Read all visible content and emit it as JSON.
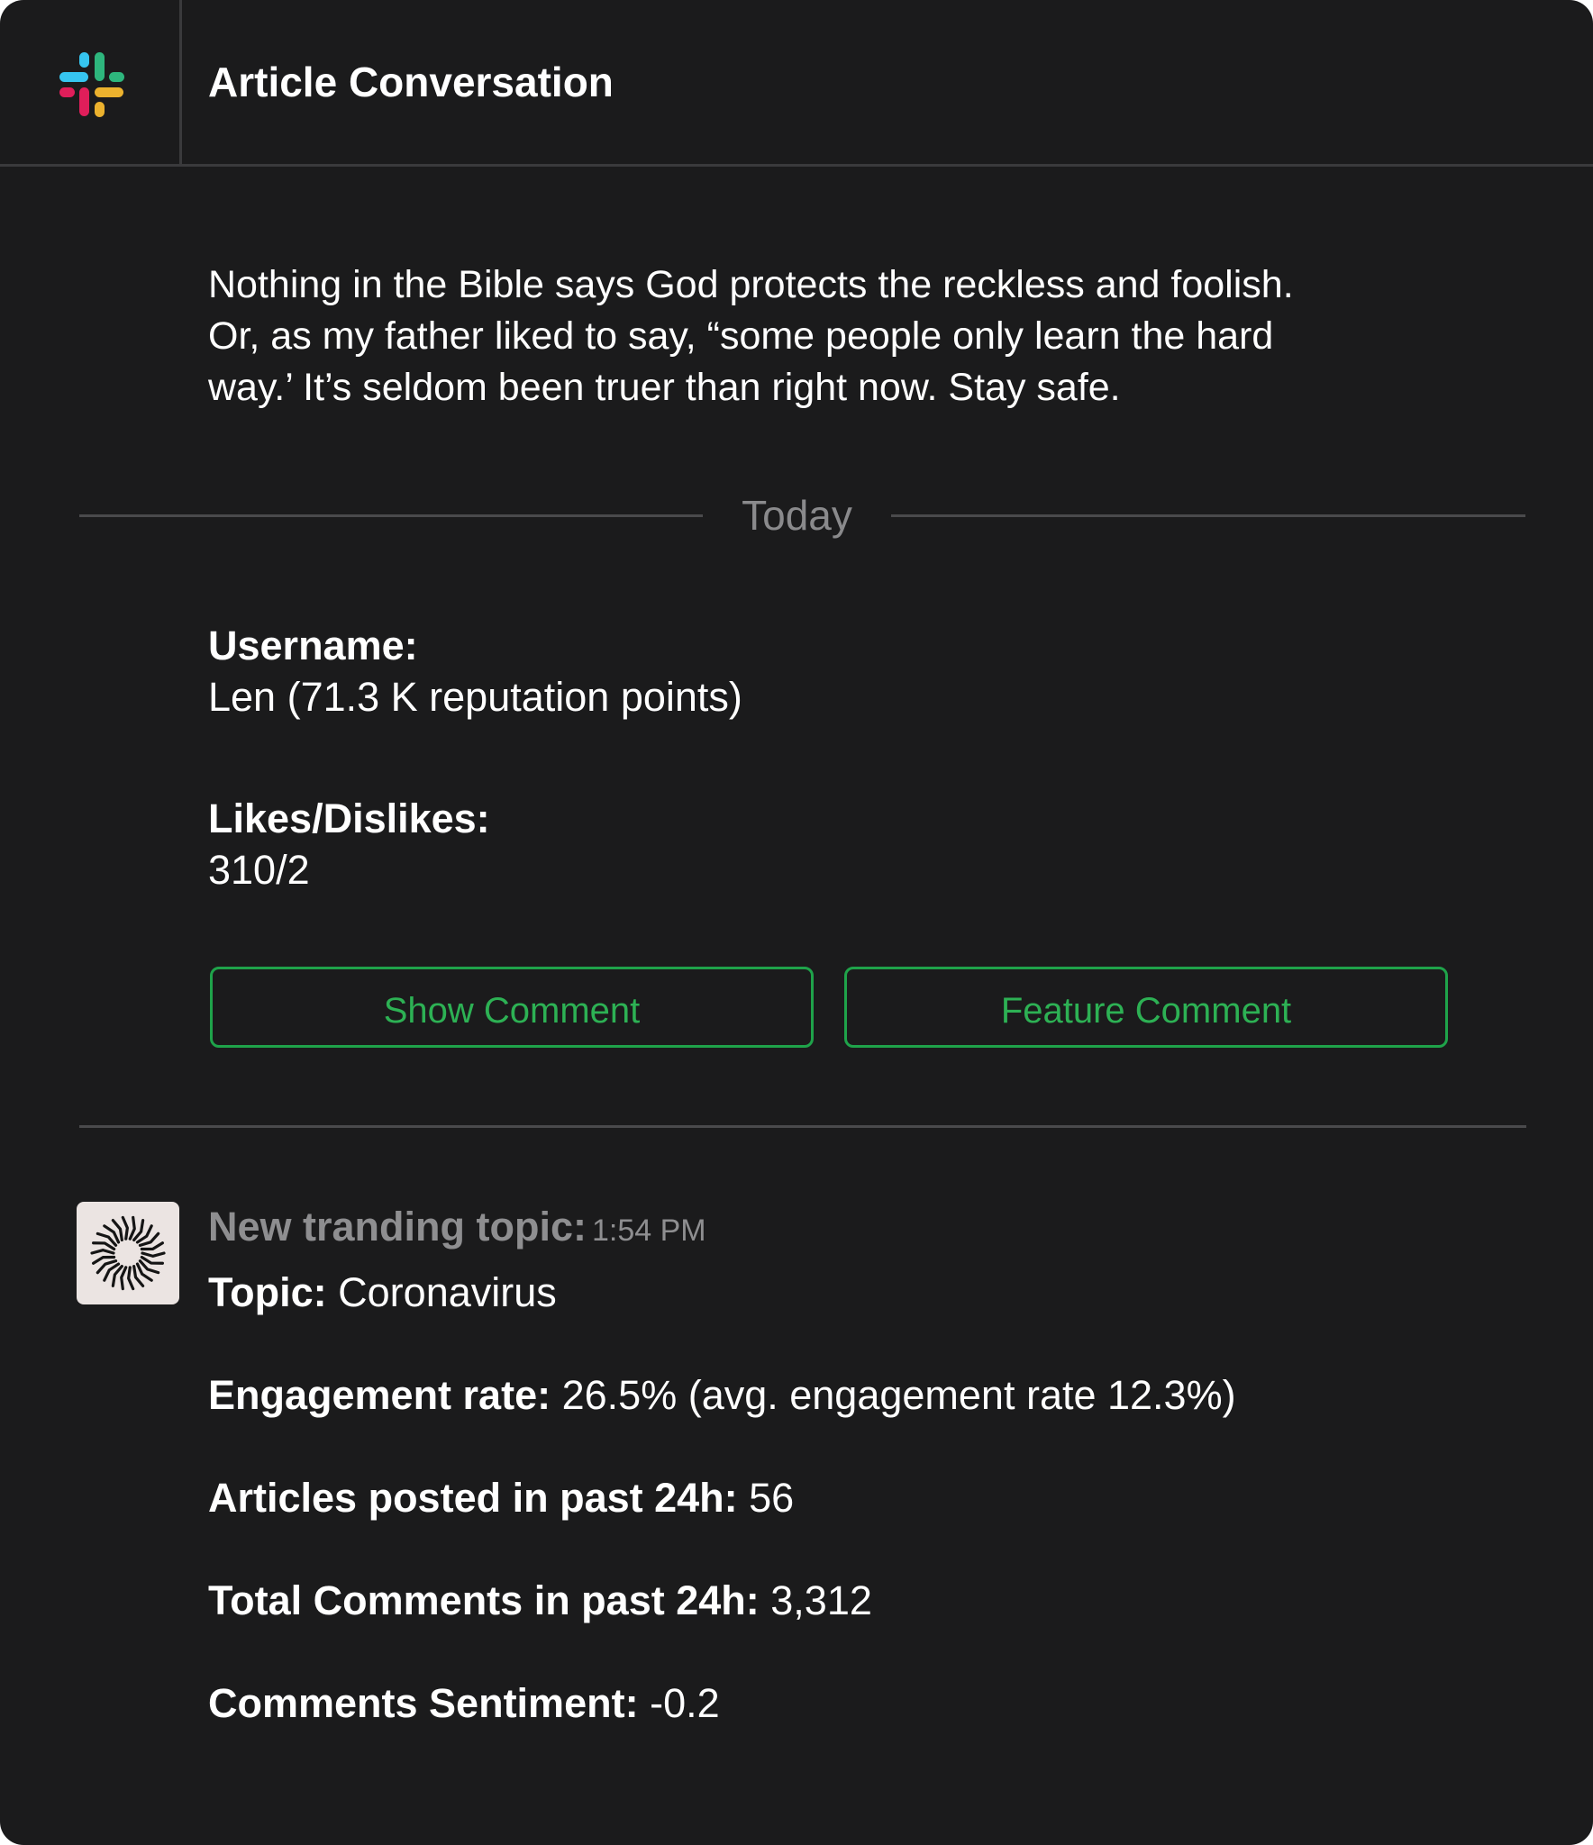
{
  "header": {
    "title": "Article Conversation",
    "logo_icon": "slack-logo-icon"
  },
  "comment": {
    "lines": [
      "Nothing in the Bible says God protects the reckless and foolish.",
      "Or, as my father liked to say, “some people only learn the hard",
      "way.’ It’s seldom been truer than right now. Stay safe."
    ]
  },
  "day_divider": "Today",
  "details": {
    "username_label": "Username:",
    "username_value": "Len (71.3 K reputation points)",
    "likes_label": "Likes/Dislikes:",
    "likes_value": "310/2"
  },
  "buttons": {
    "show": "Show Comment",
    "feature": "Feature Comment"
  },
  "message": {
    "avatar_icon": "starburst-icon",
    "sender": "New tranding topic:",
    "time": "1:54 PM",
    "stats": [
      {
        "label": "Topic:",
        "value": "Coronavirus"
      },
      {
        "label": "Engagement rate:",
        "value": "26.5% (avg. engagement rate 12.3%)"
      },
      {
        "label": "Articles posted in past 24h:",
        "value": "56"
      },
      {
        "label": "Total Comments in past 24h:",
        "value": "3,312"
      },
      {
        "label": "Comments Sentiment:",
        "value": "-0.2"
      }
    ]
  },
  "colors": {
    "background": "#1b1b1c",
    "accent_green": "#2db154",
    "muted_text": "#8e8e90",
    "divider": "#4a4a4c"
  }
}
